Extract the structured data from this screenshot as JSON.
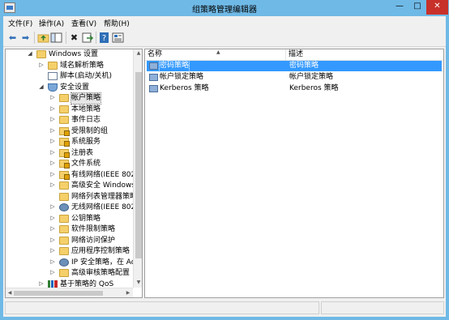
{
  "title": "组策略管理编辑器",
  "window_buttons": {
    "minimize": "—",
    "maximize": "□",
    "close": "✕"
  },
  "menu": [
    "文件(F)",
    "操作(A)",
    "查看(V)",
    "帮助(H)"
  ],
  "toolbar": [
    "back-arrow-icon",
    "forward-arrow-icon",
    "up-folder-icon",
    "show-tree-icon",
    "delete-icon",
    "export-list-icon",
    "help-icon",
    "properties-icon"
  ],
  "tree": [
    {
      "label": "Windows 设置",
      "expander": "◢",
      "icon": "folder"
    },
    {
      "label": "域名解析策略",
      "expander": "▷",
      "icon": "folder"
    },
    {
      "label": "脚本(启动/关机)",
      "expander": "",
      "icon": "doc"
    },
    {
      "label": "安全设置",
      "expander": "◢",
      "icon": "shield"
    },
    {
      "label": "帐户策略",
      "expander": "▷",
      "icon": "folder",
      "selected": true
    },
    {
      "label": "本地策略",
      "expander": "▷",
      "icon": "folder"
    },
    {
      "label": "事件日志",
      "expander": "▷",
      "icon": "folder"
    },
    {
      "label": "受限制的组",
      "expander": "▷",
      "icon": "folder-lock"
    },
    {
      "label": "系统服务",
      "expander": "▷",
      "icon": "folder-lock"
    },
    {
      "label": "注册表",
      "expander": "▷",
      "icon": "folder-lock"
    },
    {
      "label": "文件系统",
      "expander": "▷",
      "icon": "folder-lock"
    },
    {
      "label": "有线网络(IEEE 802",
      "expander": "▷",
      "icon": "folder-lock"
    },
    {
      "label": "高级安全 Windows",
      "expander": "▷",
      "icon": "folder"
    },
    {
      "label": "网络列表管理器策略",
      "expander": "",
      "icon": "folder"
    },
    {
      "label": "无线网络(IEEE 802",
      "expander": "▷",
      "icon": "network"
    },
    {
      "label": "公钥策略",
      "expander": "▷",
      "icon": "folder"
    },
    {
      "label": "软件限制策略",
      "expander": "▷",
      "icon": "folder"
    },
    {
      "label": "网络访问保护",
      "expander": "▷",
      "icon": "folder"
    },
    {
      "label": "应用程序控制策略",
      "expander": "▷",
      "icon": "folder"
    },
    {
      "label": "IP 安全策略，在 Ac",
      "expander": "▷",
      "icon": "network"
    },
    {
      "label": "高级审核策略配置",
      "expander": "▷",
      "icon": "folder"
    },
    {
      "label": "基于策略的 QoS",
      "expander": "▷",
      "icon": "chart"
    }
  ],
  "list": {
    "columns": [
      "名称",
      "描述"
    ],
    "rows": [
      {
        "name": "密码策略",
        "desc": "密码策略",
        "selected": true
      },
      {
        "name": "帐户锁定策略",
        "desc": "帐户锁定策略",
        "selected": false
      },
      {
        "name": "Kerberos 策略",
        "desc": "Kerberos 策略",
        "selected": false
      }
    ]
  }
}
